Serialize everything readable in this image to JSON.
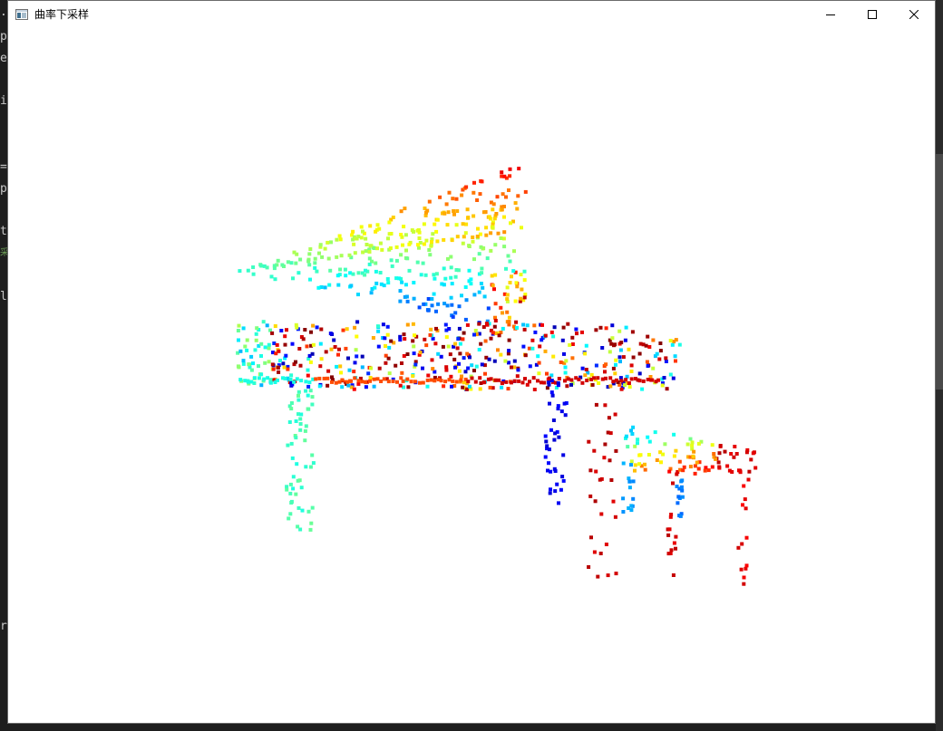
{
  "window": {
    "title": "曲率下采样",
    "icon": "app-window-icon",
    "controls": [
      "minimize-icon",
      "maximize-icon",
      "close-icon"
    ],
    "frame_color": "#6b6b6b"
  },
  "background": {
    "gutter_chars": [
      ".",
      "p",
      "e",
      "i",
      "=",
      "p",
      "t",
      "采",
      "l",
      "r"
    ],
    "editor_color": "#1e1e1e"
  },
  "viewer": {
    "content": "point-cloud of a grand piano with bench",
    "colormap": "jet",
    "colormap_stops": [
      "#00007f",
      "#0000ff",
      "#007fff",
      "#00ffff",
      "#7fff7f",
      "#ffff00",
      "#ff7f00",
      "#ff0000",
      "#7f0000"
    ],
    "background_color": "#ffffff"
  }
}
